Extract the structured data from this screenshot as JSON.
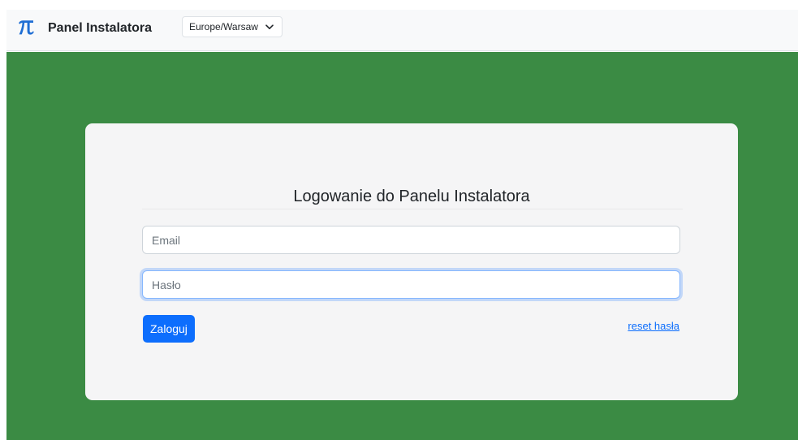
{
  "navbar": {
    "logo_icon": "pi-icon",
    "logo_color": "#1f6ed4",
    "brand_title": "Panel Instalatora",
    "timezone": {
      "selected": "Europe/Warsaw",
      "icon": "chevron-down-icon"
    }
  },
  "colors": {
    "page_background": "#3b8b44",
    "navbar_background": "#f8f9fa",
    "card_background": "#f5f5f6",
    "primary": "#0d6efd"
  },
  "login": {
    "title": "Logowanie do Panelu Instalatora",
    "email": {
      "placeholder": "Email",
      "value": ""
    },
    "password": {
      "placeholder": "Hasło",
      "value": ""
    },
    "submit_label": "Zaloguj",
    "reset_label": "reset hasła"
  }
}
